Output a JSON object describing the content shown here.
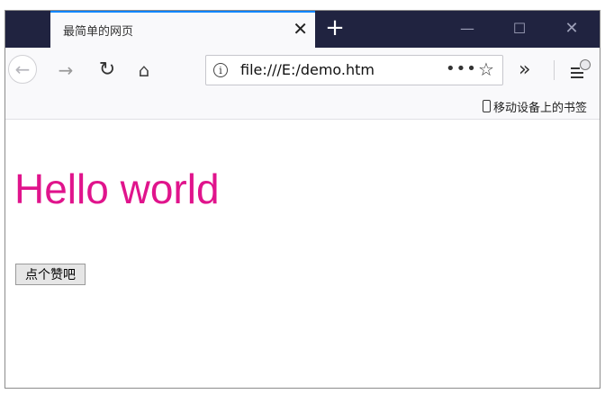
{
  "tab": {
    "title": "最简单的网页",
    "close": "✕"
  },
  "newtab": {
    "label": "+"
  },
  "window_controls": {
    "minimize": "—",
    "maximize": "☐",
    "close": "✕"
  },
  "toolbar": {
    "back": "←",
    "forward": "→",
    "reload": "↻",
    "home": "⌂",
    "url": "file:///E:/demo.htm",
    "info": "i",
    "page_actions": "•••",
    "bookmark_star": "☆",
    "overflow": "»"
  },
  "bookmarks": {
    "mobile_label": "移动设备上的书签"
  },
  "page": {
    "heading": "Hello world",
    "button_label": "点个赞吧",
    "heading_color": "#e0148c"
  }
}
